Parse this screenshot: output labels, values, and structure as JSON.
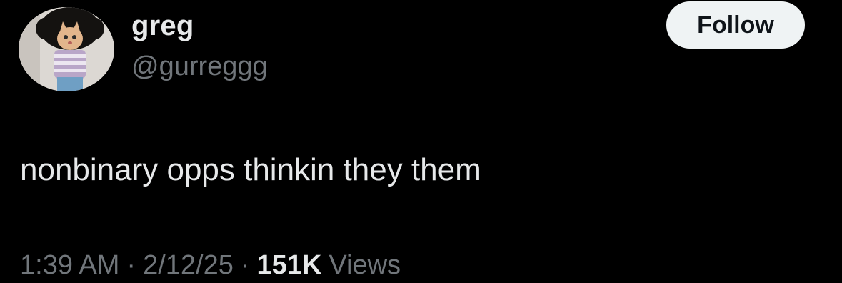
{
  "user": {
    "display_name": "greg",
    "handle": "@gurreggg",
    "avatar_icon": "cat-avatar-icon"
  },
  "follow_button": {
    "label": "Follow"
  },
  "tweet": {
    "text": "nonbinary opps thinkin they them"
  },
  "meta": {
    "time": "1:39 AM",
    "separator": "·",
    "date": "2/12/25",
    "views_count": "151K",
    "views_label": "Views"
  },
  "colors": {
    "background": "#000000",
    "primary_text": "#e7e9ea",
    "secondary_text": "#71767b",
    "follow_bg": "#eff3f4",
    "follow_text": "#0f1419"
  }
}
